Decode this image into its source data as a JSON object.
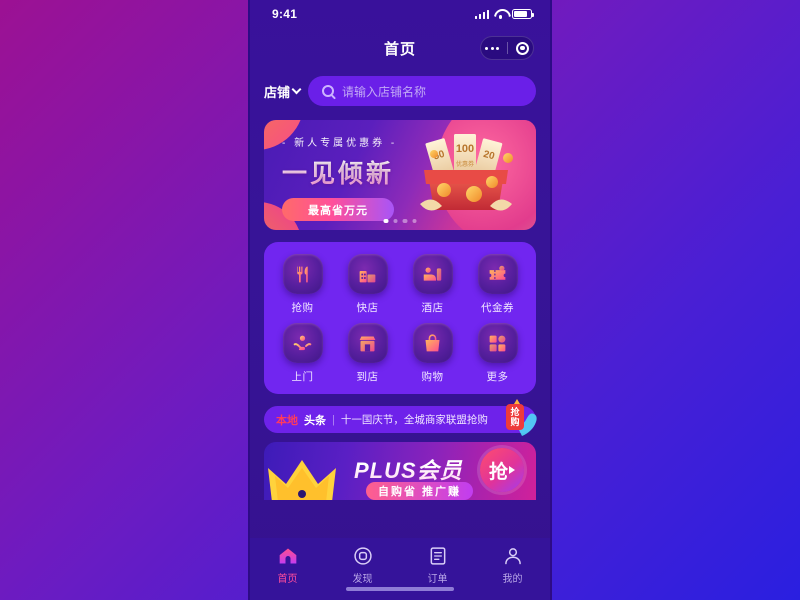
{
  "status_bar": {
    "time": "9:41",
    "signal_icon": "cellular-bars-icon",
    "wifi_icon": "wifi-icon",
    "battery_icon": "battery-icon"
  },
  "header": {
    "title": "首页",
    "more_icon": "more-dots-icon",
    "target_icon": "target-circle-icon"
  },
  "search": {
    "category_label": "店铺",
    "chevron_icon": "chevron-down-icon",
    "search_icon": "search-icon",
    "placeholder": "请输入店铺名称",
    "value": ""
  },
  "banner": {
    "subtitle": "- 新人专属优惠券 -",
    "title": "一见倾新",
    "button_label": "最高省万元",
    "gift_icon": "gift-box-icon",
    "coupon_values": [
      "50",
      "100",
      "20"
    ],
    "coupon_label": "优惠券",
    "dots_total": 4,
    "dots_active_index": 0
  },
  "grid": {
    "items": [
      {
        "label": "抢购",
        "icon": "fork-knife-icon"
      },
      {
        "label": "快店",
        "icon": "storefront-icon"
      },
      {
        "label": "酒店",
        "icon": "hotel-bed-icon"
      },
      {
        "label": "代金券",
        "icon": "voucher-ticket-icon"
      },
      {
        "label": "上门",
        "icon": "hand-service-icon"
      },
      {
        "label": "到店",
        "icon": "shop-door-icon"
      },
      {
        "label": "购物",
        "icon": "shopping-bag-icon"
      },
      {
        "label": "更多",
        "icon": "grid-more-icon"
      }
    ]
  },
  "news": {
    "tag_red": "本地",
    "tag_white": "头条",
    "divider": "|",
    "text": "十一国庆节，全城商家联盟抢购",
    "badge_label": "抢购",
    "badge_icon": "promo-megaphone-icon"
  },
  "plus_banner": {
    "title": "PLUS会员",
    "subtitle": "自购省 推广赚",
    "crown_icon": "crown-icon",
    "action_label": "抢",
    "action_icon": "play-arrow-icon"
  },
  "tabbar": {
    "items": [
      {
        "label": "首页",
        "icon": "home-icon",
        "active": true
      },
      {
        "label": "发现",
        "icon": "discover-icon",
        "active": false
      },
      {
        "label": "订单",
        "icon": "orders-icon",
        "active": false
      },
      {
        "label": "我的",
        "icon": "profile-icon",
        "active": false
      }
    ]
  },
  "colors": {
    "page_bg_start": "#9c1193",
    "page_bg_end": "#2a1fe0",
    "screen_bg": "#39119b",
    "card_bg": "#7126f0",
    "search_bg": "#6a1fe8",
    "accent_pink": "#ff4d9e",
    "accent_red": "#ff3b5c",
    "tabbar_bg": "#35139a"
  }
}
